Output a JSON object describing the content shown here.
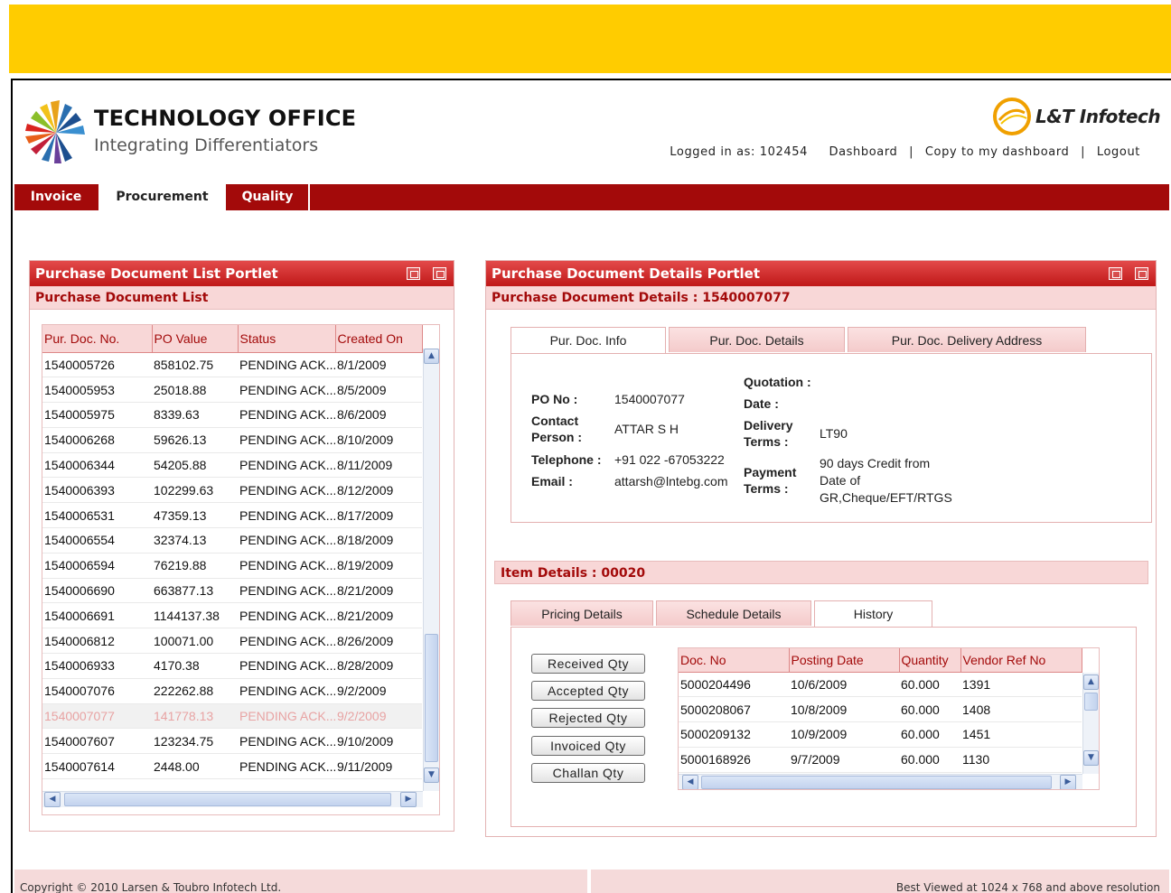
{
  "brand": {
    "title": "TECHNOLOGY OFFICE",
    "subtitle": "Integrating Differentiators",
    "partner": "L&T Infotech"
  },
  "userbar": {
    "logged_in": "Logged in as: 102454",
    "dashboard": "Dashboard",
    "copy": "Copy to my dashboard",
    "logout": "Logout",
    "separator": "|"
  },
  "nav": {
    "tabs": [
      "Invoice",
      "Procurement",
      "Quality"
    ],
    "active": "Procurement"
  },
  "colors": {
    "banner": "#ffcc00",
    "nav": "#a30a0a",
    "header": "#c01818",
    "accent_text": "#a30a0a"
  },
  "list_portlet": {
    "title": "Purchase Document List Portlet",
    "subtitle": "Purchase Document List",
    "columns": [
      "Pur. Doc. No.",
      "PO Value",
      "Status",
      "Created On"
    ],
    "rows": [
      [
        "1540005726",
        "858102.75",
        "PENDING ACK...",
        "8/1/2009"
      ],
      [
        "1540005953",
        "25018.88",
        "PENDING ACK...",
        "8/5/2009"
      ],
      [
        "1540005975",
        "8339.63",
        "PENDING ACK...",
        "8/6/2009"
      ],
      [
        "1540006268",
        "59626.13",
        "PENDING ACK...",
        "8/10/2009"
      ],
      [
        "1540006344",
        "54205.88",
        "PENDING ACK...",
        "8/11/2009"
      ],
      [
        "1540006393",
        "102299.63",
        "PENDING ACK...",
        "8/12/2009"
      ],
      [
        "1540006531",
        "47359.13",
        "PENDING ACK...",
        "8/17/2009"
      ],
      [
        "1540006554",
        "32374.13",
        "PENDING ACK...",
        "8/18/2009"
      ],
      [
        "1540006594",
        "76219.88",
        "PENDING ACK...",
        "8/19/2009"
      ],
      [
        "1540006690",
        "663877.13",
        "PENDING ACK...",
        "8/21/2009"
      ],
      [
        "1540006691",
        "1144137.38",
        "PENDING ACK...",
        "8/21/2009"
      ],
      [
        "1540006812",
        "100071.00",
        "PENDING ACK...",
        "8/26/2009"
      ],
      [
        "1540006933",
        "4170.38",
        "PENDING ACK...",
        "8/28/2009"
      ],
      [
        "1540007076",
        "222262.88",
        "PENDING ACK...",
        "9/2/2009"
      ],
      [
        "1540007077",
        "141778.13",
        "PENDING ACK...",
        "9/2/2009"
      ],
      [
        "1540007607",
        "123234.75",
        "PENDING ACK...",
        "9/10/2009"
      ],
      [
        "1540007614",
        "2448.00",
        "PENDING ACK...",
        "9/11/2009"
      ]
    ],
    "selected_row": 14
  },
  "details_portlet": {
    "title": "Purchase Document Details Portlet",
    "subtitle": "Purchase Document Details : 1540007077",
    "tabs": [
      "Pur. Doc. Info",
      "Pur. Doc. Details",
      "Pur. Doc. Delivery Address"
    ],
    "active_tab": 0,
    "info": {
      "po_no_label": "PO No :",
      "po_no": "1540007077",
      "contact_label_1": "Contact",
      "contact_label_2": "Person :",
      "contact": "ATTAR S H",
      "telephone_label": "Telephone :",
      "telephone": "+91 022 -67053222",
      "email_label": "Email :",
      "email": "attarsh@lntebg.com",
      "quotation_label": "Quotation :",
      "date_label": "Date :",
      "delivery_label_1": "Delivery",
      "delivery_label_2": "Terms :",
      "delivery": "LT90",
      "payment_label_1": "Payment",
      "payment_label_2": "Terms :",
      "payment_1": "90 days Credit from",
      "payment_2": "Date of",
      "payment_3": "GR,Cheque/EFT/RTGS"
    },
    "item_subtitle": "Item Details : 00020",
    "item_tabs": [
      "Pricing Details",
      "Schedule Details",
      "History"
    ],
    "active_item_tab": 2,
    "qty_buttons": [
      "Received Qty",
      "Accepted Qty",
      "Rejected Qty",
      "Invoiced Qty",
      "Challan Qty"
    ],
    "history": {
      "columns": [
        "Doc. No",
        "Posting Date",
        "Quantity",
        "Vendor Ref No"
      ],
      "rows": [
        [
          "5000204496",
          "10/6/2009",
          "60.000",
          "1391"
        ],
        [
          "5000208067",
          "10/8/2009",
          "60.000",
          "1408"
        ],
        [
          "5000209132",
          "10/9/2009",
          "60.000",
          "1451"
        ],
        [
          "5000168926",
          "9/7/2009",
          "60.000",
          "1130"
        ]
      ]
    }
  },
  "footer": {
    "copyright": "Copyright © 2010 Larsen & Toubro Infotech Ltd.",
    "resolution": "Best Viewed at 1024 x 768 and above resolution"
  }
}
